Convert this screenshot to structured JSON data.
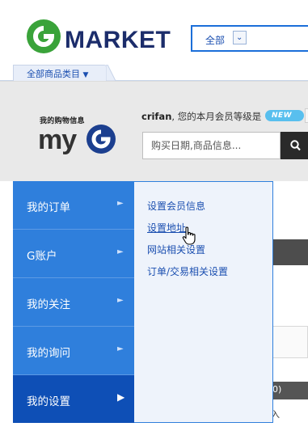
{
  "header": {
    "logo_text": "GMARKET",
    "search_scope": {
      "selected": "全部",
      "arrow_icon": "chevron-down-icon"
    },
    "category_tab_label": "全部商品类目"
  },
  "banner": {
    "mini_title": "我的购物信息",
    "myg_logo_text": "myG",
    "user_name": "crifan",
    "user_suffix": ", 您的本月会员等级是",
    "badge_label": "NEW",
    "search_placeholder": "购买日期,商品信息...",
    "search_icon": "search-icon"
  },
  "background": {
    "count_label": "0)",
    "small_text": "入"
  },
  "menu": {
    "items": [
      {
        "label": "我的订单",
        "active": false,
        "arrow": "chevron-right-icon"
      },
      {
        "label": "G账户",
        "active": false,
        "arrow": "chevron-right-icon"
      },
      {
        "label": "我的关注",
        "active": false,
        "arrow": "chevron-right-icon"
      },
      {
        "label": "我的询问",
        "active": false,
        "arrow": "chevron-right-icon"
      },
      {
        "label": "我的设置",
        "active": true,
        "arrow": "chevron-right-icon"
      }
    ],
    "submenu": [
      {
        "label": "设置会员信息"
      },
      {
        "label": "设置地址",
        "hovered": true
      },
      {
        "label": "网站相关设置"
      },
      {
        "label": "订单/交易相关设置"
      }
    ]
  },
  "colors": {
    "brand_green": "#3aa33a",
    "brand_navy": "#1c2d6b",
    "menu_blue": "#2f7fdc",
    "menu_active": "#0e4fb6",
    "submenu_bg": "#eef3fb",
    "link_blue": "#1b4fb0",
    "badge_blue": "#58bfee"
  },
  "cursor_icon": "hand-pointer-icon"
}
